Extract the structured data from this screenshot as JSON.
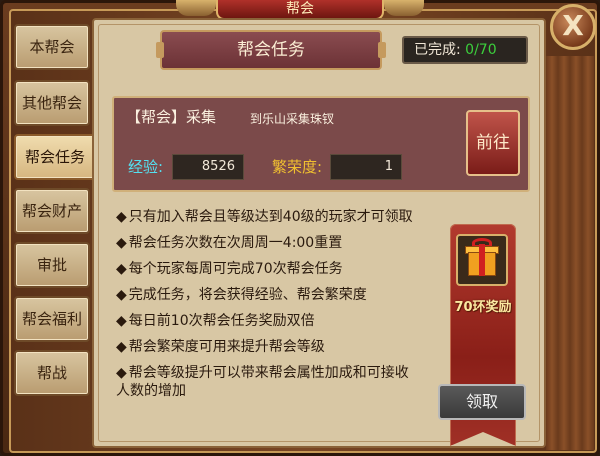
{
  "window": {
    "title": "帮会",
    "close_label": "X"
  },
  "tabs": [
    {
      "label": "本帮会",
      "active": false
    },
    {
      "label": "其他帮会",
      "active": false
    },
    {
      "label": "帮会任务",
      "active": true
    },
    {
      "label": "帮会财产",
      "active": false
    },
    {
      "label": "审批",
      "active": false
    },
    {
      "label": "帮会福利",
      "active": false
    },
    {
      "label": "帮战",
      "active": false
    }
  ],
  "header": {
    "title": "帮会任务",
    "completed_label": "已完成:",
    "completed_value": "0/70"
  },
  "task": {
    "title": "【帮会】采集",
    "description": "到乐山采集珠钗",
    "exp_label": "经验:",
    "exp_value": "8526",
    "prosperity_label": "繁荣度:",
    "prosperity_value": "1",
    "goto_label": "前往"
  },
  "rules": [
    "只有加入帮会且等级达到40级的玩家才可领取",
    "帮会任务次数在次周周一4:00重置",
    "每个玩家每周可完成70次帮会任务",
    "完成任务，将会获得经验、帮会繁荣度",
    "每日前10次帮会任务奖励双倍",
    "帮会繁荣度可用来提升帮会等级",
    "帮会等级提升可以带来帮会属性加成和可接收人数的增加"
  ],
  "reward": {
    "label": "70环奖励",
    "icon": "gift-box-icon",
    "claim_label": "领取"
  },
  "colors": {
    "exp": "#54e0f0",
    "prosperity": "#f0c030",
    "completed_value": "#3ccf3c"
  }
}
